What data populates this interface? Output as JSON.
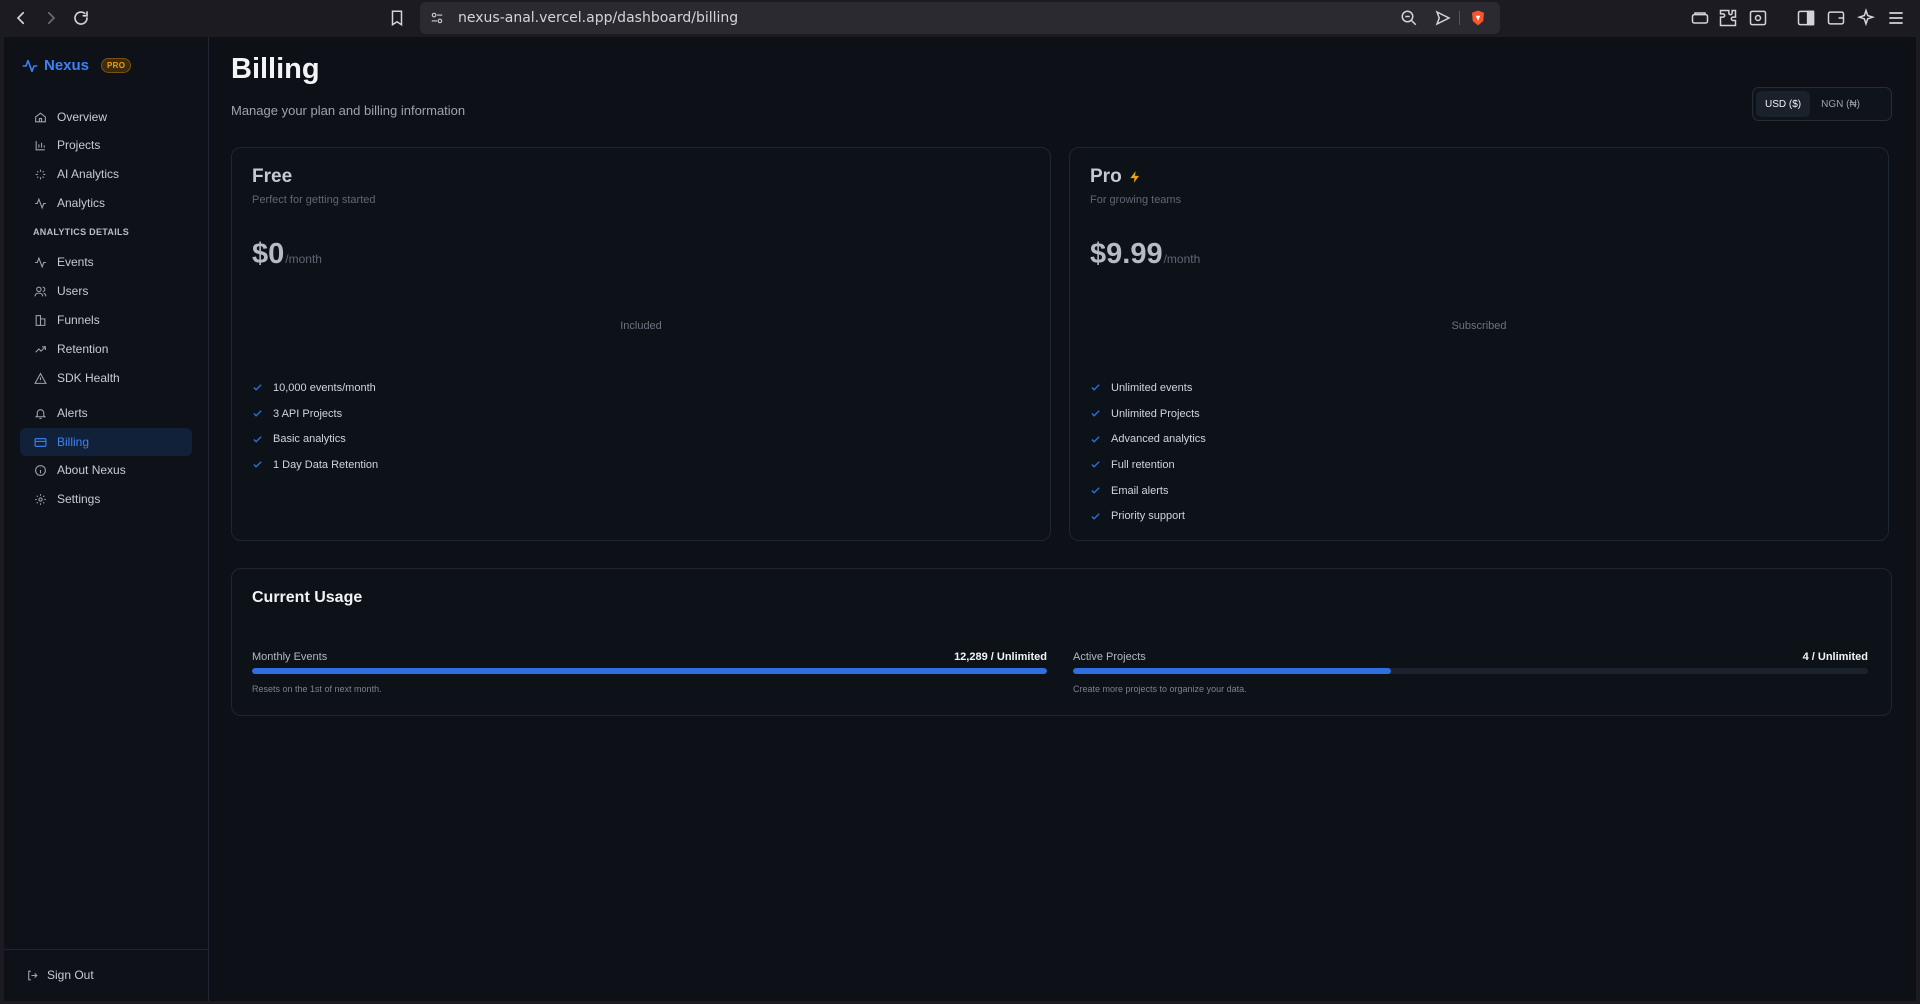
{
  "browser": {
    "url": "nexus-anal.vercel.app/dashboard/billing"
  },
  "sidebar": {
    "brand": "Nexus",
    "badge": "PRO",
    "items": [
      {
        "label": "Overview",
        "icon": "home-icon"
      },
      {
        "label": "Projects",
        "icon": "bar-chart-icon"
      },
      {
        "label": "AI Analytics",
        "icon": "sparkles-icon"
      },
      {
        "label": "Analytics",
        "icon": "activity-icon"
      }
    ],
    "section_label": "ANALYTICS DETAILS",
    "detail_items": [
      {
        "label": "Events",
        "icon": "activity-icon"
      },
      {
        "label": "Users",
        "icon": "users-icon"
      },
      {
        "label": "Funnels",
        "icon": "funnel-icon"
      },
      {
        "label": "Retention",
        "icon": "trending-up-icon"
      },
      {
        "label": "SDK Health",
        "icon": "warning-icon"
      }
    ],
    "bottom_items": [
      {
        "label": "Alerts",
        "icon": "bell-icon"
      },
      {
        "label": "Billing",
        "icon": "credit-card-icon",
        "active": true
      },
      {
        "label": "About Nexus",
        "icon": "info-icon"
      },
      {
        "label": "Settings",
        "icon": "gear-icon"
      }
    ],
    "sign_out": "Sign Out"
  },
  "page": {
    "title": "Billing",
    "subtitle": "Manage your plan and billing information"
  },
  "currency": {
    "options": [
      "USD ($)",
      "NGN (₦)"
    ],
    "selected": "USD ($)"
  },
  "plans": [
    {
      "name": "Free",
      "description": "Perfect for getting started",
      "price": "$0",
      "period": "/month",
      "status": "Included",
      "features": [
        "10,000 events/month",
        "3 API Projects",
        "Basic analytics",
        "1 Day Data Retention"
      ]
    },
    {
      "name": "Pro",
      "description": "For growing teams",
      "price": "$9.99",
      "period": "/month",
      "status": "Subscribed",
      "features": [
        "Unlimited events",
        "Unlimited Projects",
        "Advanced analytics",
        "Full retention",
        "Email alerts",
        "Priority support"
      ]
    }
  ],
  "usage": {
    "title": "Current Usage",
    "meters": [
      {
        "label": "Monthly Events",
        "value": "12,289 / Unlimited",
        "note": "Resets on the 1st of next month.",
        "fill_fraction": 1.0
      },
      {
        "label": "Active Projects",
        "value": "4 / Unlimited",
        "note": "Create more projects to organize your data.",
        "fill_fraction": 0.4
      }
    ]
  },
  "colors": {
    "accent": "#3b82f6",
    "background": "#0d1117",
    "pro_badge": "#f59e0b"
  }
}
